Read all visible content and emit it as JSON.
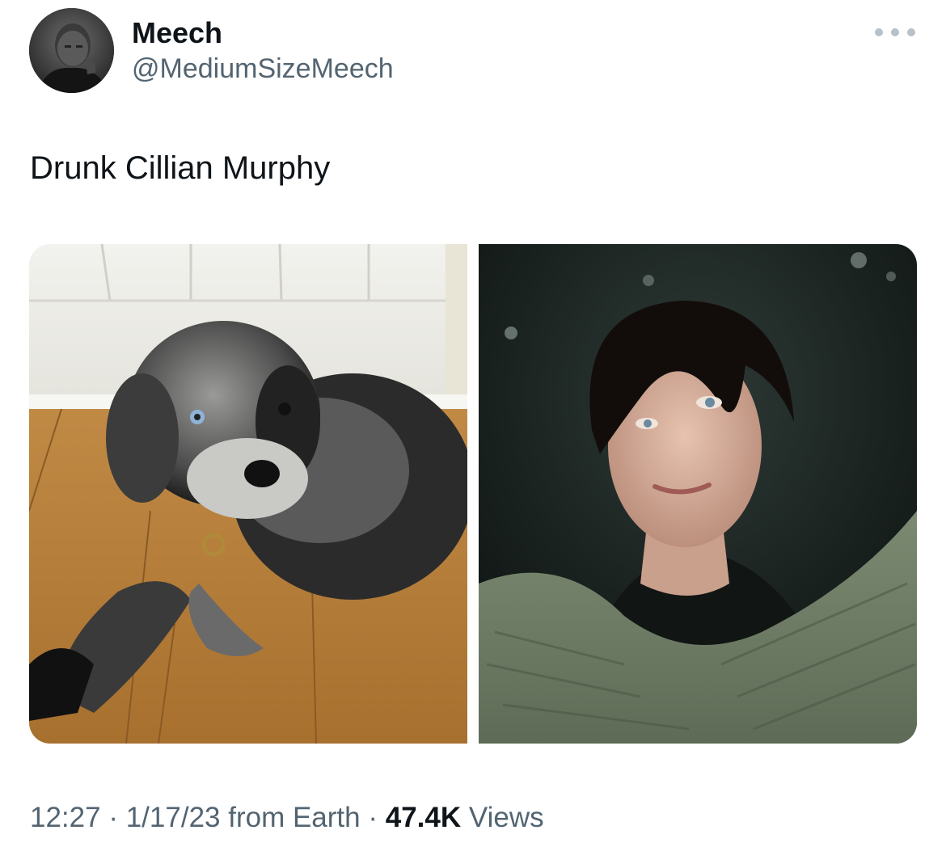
{
  "author": {
    "display_name": "Meech",
    "handle": "@MediumSizeMeech",
    "avatar_icon": "profile-photo"
  },
  "menu": {
    "icon": "more-horizontal-icon"
  },
  "tweet": {
    "text": "Drunk Cillian Murphy"
  },
  "media": {
    "images": [
      {
        "subject": "grey merle poodle-mix dog lying on wooden floor"
      },
      {
        "subject": "young man with dark hair in a green knit sweater"
      }
    ]
  },
  "meta": {
    "time": "12:27",
    "sep1": "·",
    "date": "1/17/23",
    "source": "from Earth",
    "sep2": "·",
    "views_count": "47.4K",
    "views_label": "Views"
  },
  "colors": {
    "text_primary": "#0f1419",
    "text_secondary": "#536471",
    "dots": "#b8c0c8",
    "background": "#ffffff"
  }
}
